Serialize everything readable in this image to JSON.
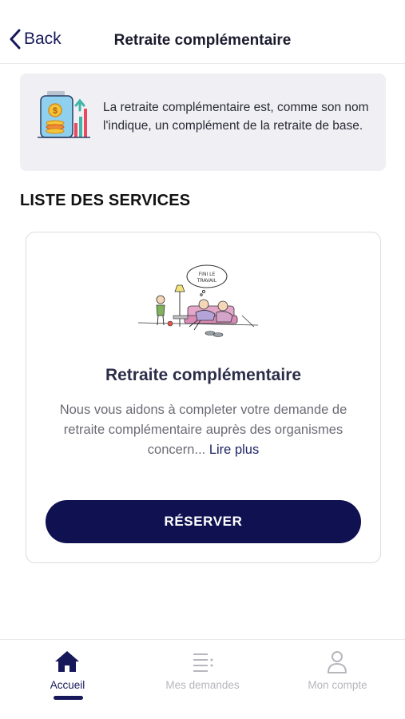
{
  "header": {
    "back_label": "Back",
    "title": "Retraite complémentaire"
  },
  "info": {
    "icon": "savings-growth-icon",
    "text": "La retraite complémentaire est, comme son nom l'indique, un complément de la retraite de base."
  },
  "services": {
    "section_title": "LISTE DES SERVICES",
    "items": [
      {
        "illustration": "retired-couple-illustration",
        "illustration_caption": "FINI LE TRAVAIL",
        "title": "Retraite complémentaire",
        "description": "Nous vous aidons à completer votre demande de retraite complémentaire auprès des organismes concern...",
        "read_more": "Lire plus",
        "button_label": "RÉSERVER"
      }
    ]
  },
  "tabbar": {
    "tabs": [
      {
        "label": "Accueil",
        "icon": "home-icon",
        "active": true
      },
      {
        "label": "Mes demandes",
        "icon": "list-icon",
        "active": false
      },
      {
        "label": "Mon compte",
        "icon": "user-icon",
        "active": false
      }
    ]
  },
  "colors": {
    "primary": "#0f1150",
    "info_bg": "#f0f0f4",
    "inactive": "#b6b6bd"
  }
}
